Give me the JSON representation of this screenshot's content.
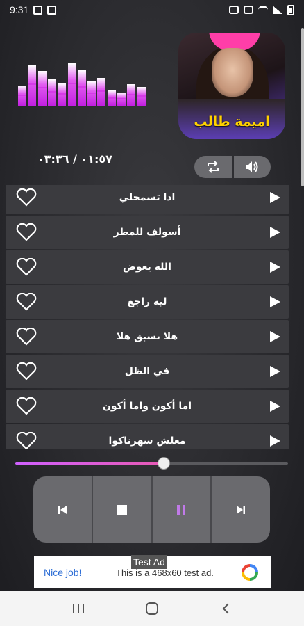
{
  "status_bar": {
    "time": "9:31"
  },
  "visualizer": {
    "levels": [
      0.45,
      0.9,
      0.78,
      0.6,
      0.5,
      0.95,
      0.8,
      0.55,
      0.62,
      0.35,
      0.3,
      0.48,
      0.42
    ]
  },
  "album": {
    "title": "اميمة طالب"
  },
  "time_display": "٠١:٥٧ / ٠٣:٣٦",
  "tracks": [
    {
      "title": "اذا تسمحلي"
    },
    {
      "title": "أسولف للمطر"
    },
    {
      "title": "الله يعوض"
    },
    {
      "title": "ليه راجع"
    },
    {
      "title": "هلا تسبق هلا"
    },
    {
      "title": "في الظل"
    },
    {
      "title": "اما أكون واما أكون"
    },
    {
      "title": "معلش سهرناكوا"
    }
  ],
  "progress": {
    "fraction": 0.545
  },
  "colors": {
    "accent": "#d83fe6",
    "pause_accent": "#c07ae8",
    "ad_link": "#2f6fd6"
  },
  "ad": {
    "label": "Test Ad",
    "left_text": "Nice job!",
    "middle_text": "This is a 468x60 test ad."
  },
  "icons": {
    "repeat": "repeat-icon",
    "volume": "volume-icon",
    "heart": "heart-outline-icon",
    "play": "play-icon",
    "prev": "skip-previous-icon",
    "stop": "stop-icon",
    "pause": "pause-icon",
    "next": "skip-next-icon"
  }
}
